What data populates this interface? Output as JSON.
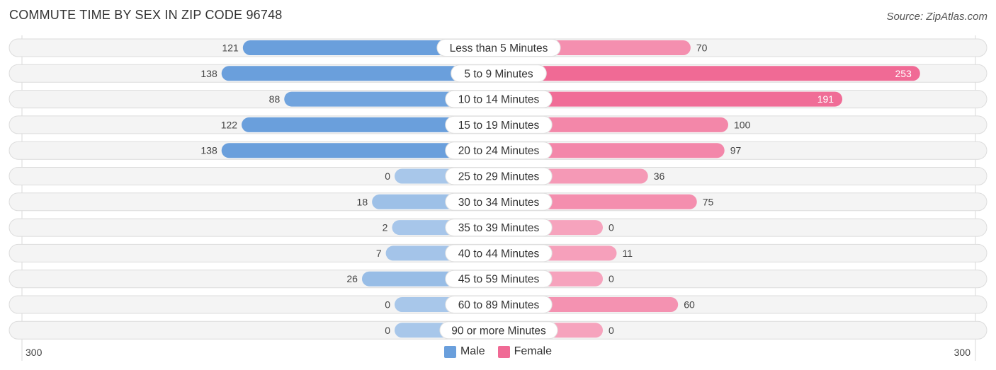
{
  "header": {
    "title": "COMMUTE TIME BY SEX IN ZIP CODE 96748",
    "source": "Source: ZipAtlas.com"
  },
  "colors": {
    "male": "#6a9fdc",
    "male_light": "#a8c7ea",
    "female": "#f06a95",
    "female_light": "#f6a3bd"
  },
  "chart_data": {
    "type": "bar",
    "orientation": "horizontal-diverging",
    "title": "COMMUTE TIME BY SEX IN ZIP CODE 96748",
    "categories": [
      "Less than 5 Minutes",
      "5 to 9 Minutes",
      "10 to 14 Minutes",
      "15 to 19 Minutes",
      "20 to 24 Minutes",
      "25 to 29 Minutes",
      "30 to 34 Minutes",
      "35 to 39 Minutes",
      "40 to 44 Minutes",
      "45 to 59 Minutes",
      "60 to 89 Minutes",
      "90 or more Minutes"
    ],
    "series": [
      {
        "name": "Male",
        "values": [
          121,
          138,
          88,
          122,
          138,
          0,
          18,
          2,
          7,
          26,
          0,
          0
        ]
      },
      {
        "name": "Female",
        "values": [
          70,
          253,
          191,
          100,
          97,
          36,
          75,
          0,
          11,
          0,
          60,
          0
        ]
      }
    ],
    "axis_labels": {
      "left": "300",
      "right": "300"
    },
    "xlim": [
      -300,
      300
    ],
    "legend": {
      "position": "bottom-center",
      "items": [
        "Male",
        "Female"
      ]
    }
  }
}
